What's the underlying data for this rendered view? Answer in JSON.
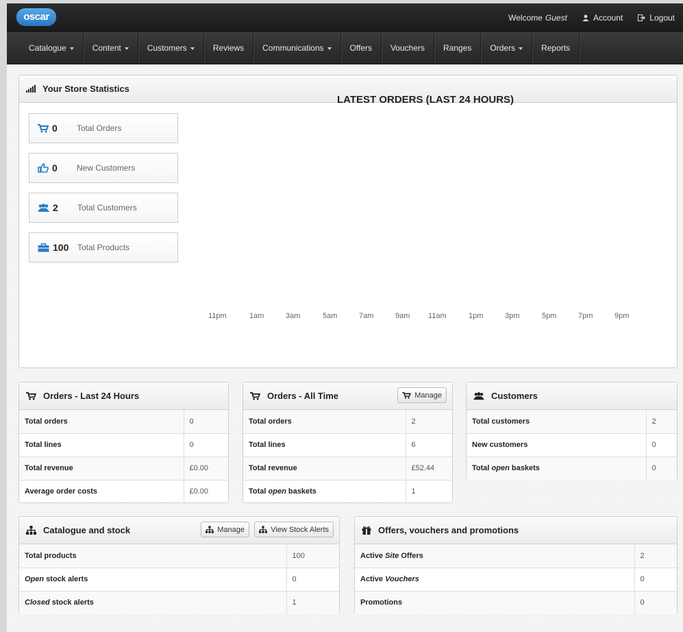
{
  "brand": {
    "logo": "oscar"
  },
  "topnav": {
    "welcome": "Welcome",
    "user": "Guest",
    "account": "Account",
    "logout": "Logout"
  },
  "nav": [
    "Catalogue",
    "Content",
    "Customers",
    "Reviews",
    "Communications",
    "Offers",
    "Vouchers",
    "Ranges",
    "Orders",
    "Reports"
  ],
  "statistics": {
    "title": "Your Store Statistics",
    "boxes": [
      {
        "icon": "cart-icon",
        "value": "0",
        "label": "Total Orders"
      },
      {
        "icon": "thumbs-up-icon",
        "value": "0",
        "label": "New Customers"
      },
      {
        "icon": "group-icon",
        "value": "2",
        "label": "Total Customers"
      },
      {
        "icon": "briefcase-icon",
        "value": "100",
        "label": "Total Products"
      }
    ],
    "chart_title": "LATEST ORDERS (LAST 24 HOURS)",
    "ticks": [
      "11pm",
      "1am",
      "3am",
      "5am",
      "7am",
      "9am",
      "11am",
      "1pm",
      "3pm",
      "5pm",
      "7pm",
      "9pm"
    ]
  },
  "orders24": {
    "title": "Orders - Last 24 Hours",
    "rows": [
      {
        "k": "Total orders",
        "v": "0"
      },
      {
        "k": "Total lines",
        "v": "0"
      },
      {
        "k": "Total revenue",
        "v": "£0.00"
      },
      {
        "k": "Average order costs",
        "v": "£0.00"
      }
    ]
  },
  "ordersAll": {
    "title": "Orders - All Time",
    "manage": "Manage",
    "rows": [
      {
        "k": "Total orders",
        "v": "2"
      },
      {
        "k": "Total lines",
        "v": "6"
      },
      {
        "k": "Total revenue",
        "v": "£52.44"
      },
      {
        "k": "Total",
        "em": "open",
        "k2": "baskets",
        "v": "1"
      }
    ]
  },
  "customers": {
    "title": "Customers",
    "rows": [
      {
        "k": "Total customers",
        "v": "2"
      },
      {
        "k": "New customers",
        "v": "0"
      },
      {
        "k": "Total",
        "em": "open",
        "k2": "baskets",
        "v": "0"
      }
    ]
  },
  "catalogue": {
    "title": "Catalogue and stock",
    "manage": "Manage",
    "alerts": "View Stock Alerts",
    "rows": [
      {
        "k": "Total products",
        "v": "100"
      },
      {
        "em": "Open",
        "k2": "stock alerts",
        "v": "0"
      },
      {
        "em": "Closed",
        "k2": "stock alerts",
        "v": "1"
      }
    ]
  },
  "offers": {
    "title": "Offers, vouchers and promotions",
    "rows": [
      {
        "k": "Active",
        "em": "Site",
        "k2": "Offers",
        "v": "2"
      },
      {
        "k": "Active",
        "em": "Vouchers",
        "k2": "",
        "v": "0"
      },
      {
        "k": "Promotions",
        "v": "0"
      }
    ]
  }
}
